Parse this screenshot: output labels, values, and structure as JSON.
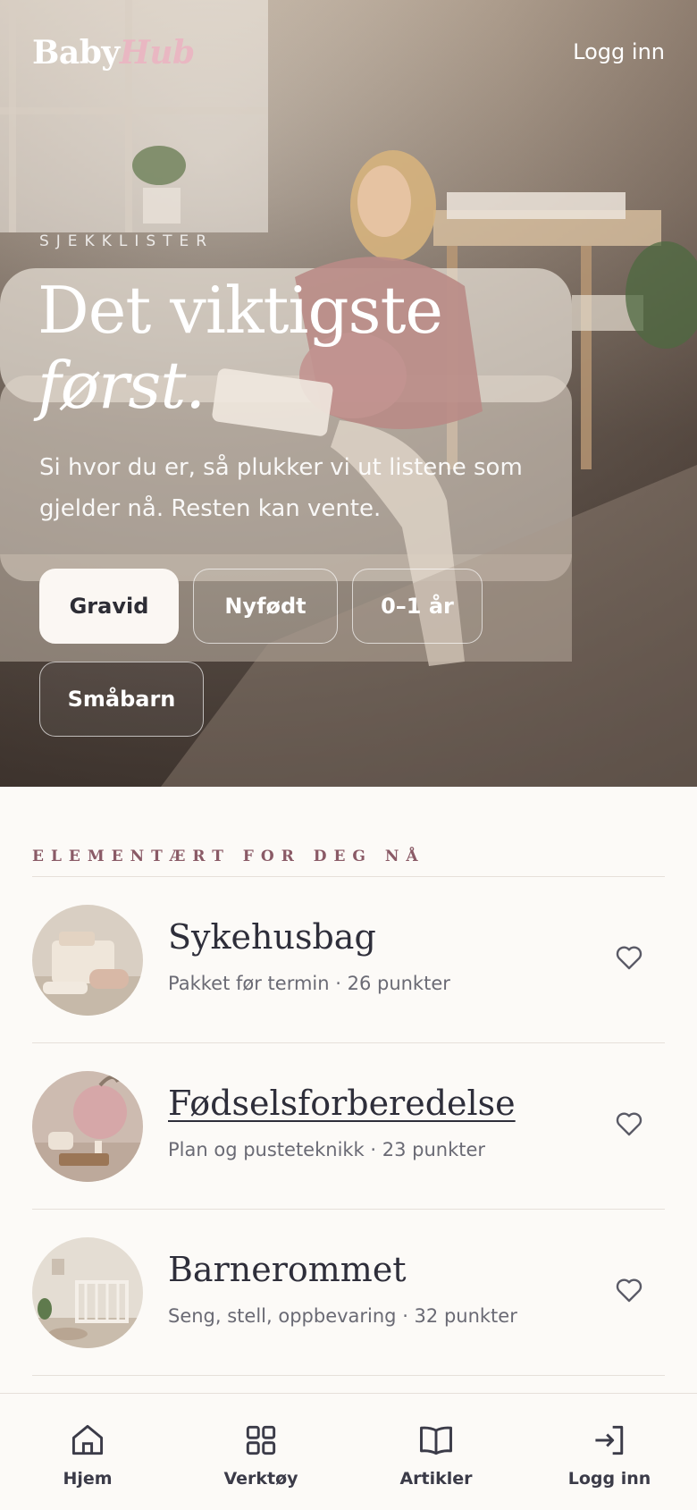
{
  "brand": {
    "name_part1": "Baby",
    "name_part2": "Hub"
  },
  "header": {
    "login_label": "Logg inn"
  },
  "hero": {
    "eyebrow": "SJEKKLISTER",
    "title_line1": "Det viktigste",
    "title_line2": "først.",
    "subtitle": "Si hvor du er, så plukker vi ut listene som gjelder nå. Resten kan vente.",
    "chips": [
      {
        "label": "Gravid",
        "selected": true
      },
      {
        "label": "Nyfødt",
        "selected": false
      },
      {
        "label": "0–1 år",
        "selected": false
      },
      {
        "label": "Småbarn",
        "selected": false
      }
    ]
  },
  "section": {
    "heading": "ELEMENTÆRT FOR DEG NÅ",
    "items": [
      {
        "title": "Sykehusbag",
        "meta": "Pakket før termin · 26 punkter",
        "favorite": false,
        "icon": "heart-outline-icon"
      },
      {
        "title": "Fødselsforberedelse",
        "meta": "Plan og pusteteknikk · 23 punkter",
        "favorite": false,
        "icon": "heart-outline-icon"
      },
      {
        "title": "Barnerommet",
        "meta": "Seng, stell, oppbevaring · 32 punkter",
        "favorite": false,
        "icon": "heart-outline-icon"
      }
    ]
  },
  "bottom_nav": {
    "items": [
      {
        "label": "Hjem",
        "icon": "home-icon"
      },
      {
        "label": "Verktøy",
        "icon": "grid-icon"
      },
      {
        "label": "Artikler",
        "icon": "book-icon"
      },
      {
        "label": "Logg inn",
        "icon": "login-icon"
      }
    ]
  },
  "colors": {
    "background": "#fcfaf7",
    "accent_pink": "#e9b7c2",
    "section_heading": "#8a5a66",
    "text_dark": "#2d2d35",
    "text_muted": "#6a6a74"
  }
}
